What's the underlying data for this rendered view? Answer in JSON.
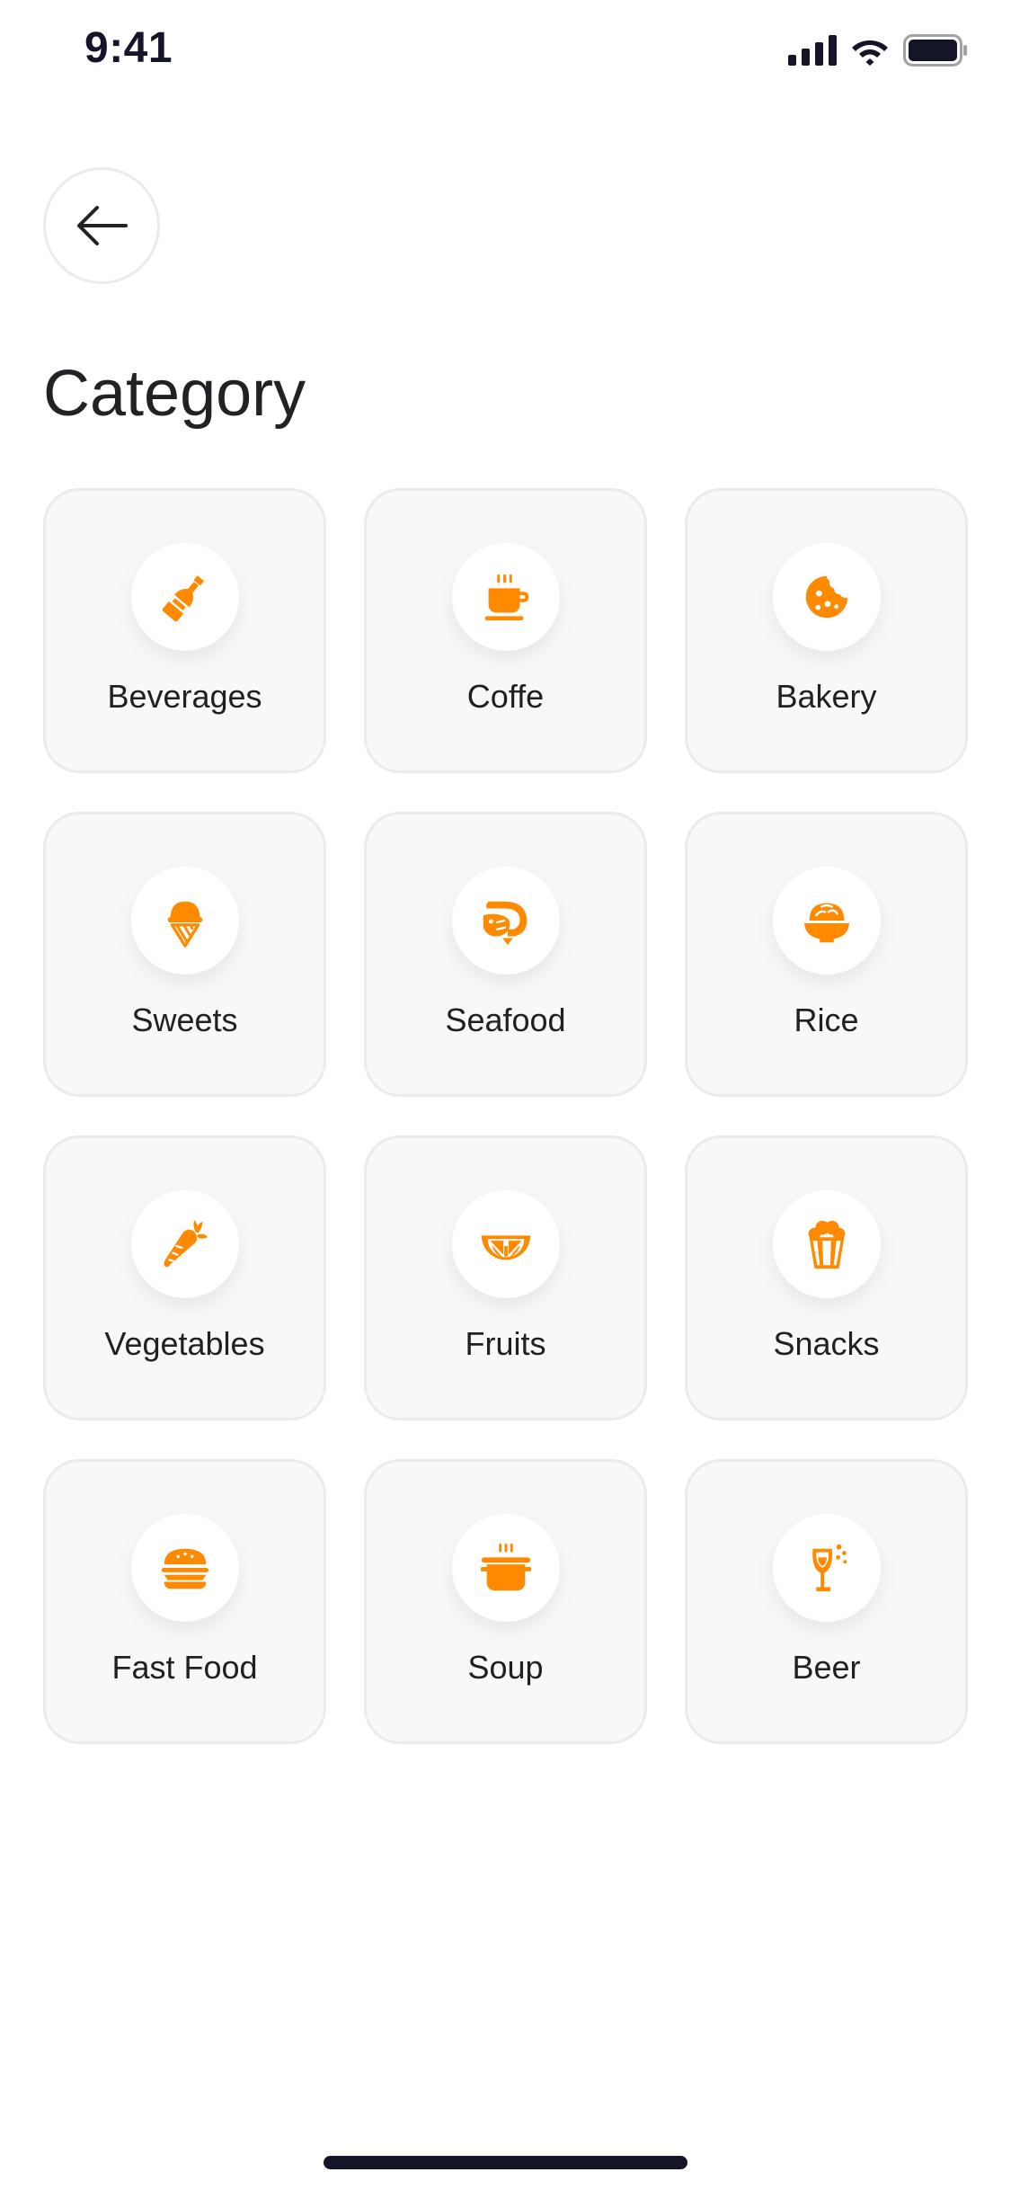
{
  "status_bar": {
    "time": "9:41",
    "icons": [
      "cellular-signal-icon",
      "wifi-icon",
      "battery-icon"
    ]
  },
  "header": {
    "back_icon": "arrow-left-icon",
    "title": "Category"
  },
  "theme": {
    "accent": "#FF8A00",
    "card_background": "#F8F8F8",
    "card_border": "#EBEBEB",
    "text": "#222226"
  },
  "categories": [
    {
      "label": "Beverages",
      "icon": "bottle-icon"
    },
    {
      "label": "Coffe",
      "icon": "coffee-cup-icon"
    },
    {
      "label": "Bakery",
      "icon": "cookie-icon"
    },
    {
      "label": "Sweets",
      "icon": "ice-cream-icon"
    },
    {
      "label": "Seafood",
      "icon": "shrimp-icon"
    },
    {
      "label": "Rice",
      "icon": "rice-bowl-icon"
    },
    {
      "label": "Vegetables",
      "icon": "carrot-icon"
    },
    {
      "label": "Fruits",
      "icon": "orange-slice-icon"
    },
    {
      "label": "Snacks",
      "icon": "popcorn-icon"
    },
    {
      "label": "Fast Food",
      "icon": "burger-icon"
    },
    {
      "label": "Soup",
      "icon": "soup-pot-icon"
    },
    {
      "label": "Beer",
      "icon": "wine-glass-icon"
    }
  ]
}
